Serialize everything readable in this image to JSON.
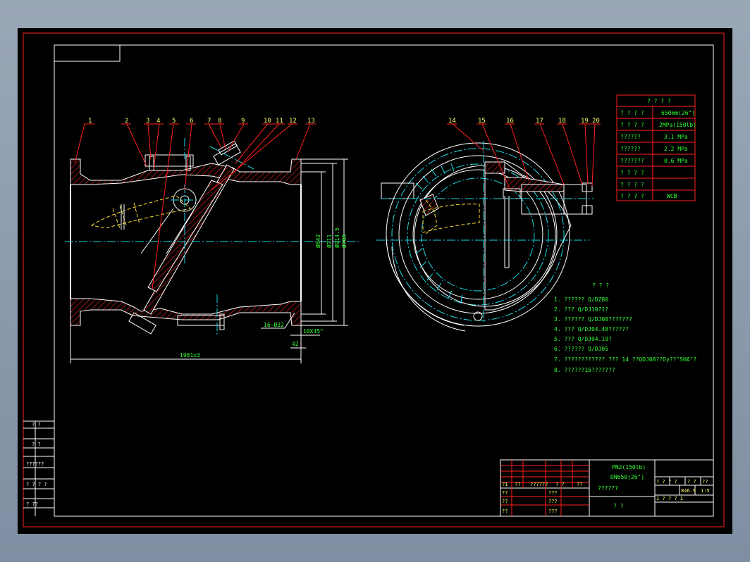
{
  "balloons": [
    "1",
    "2",
    "3",
    "4",
    "5",
    "6",
    "7",
    "8",
    "9",
    "10",
    "11",
    "12",
    "13",
    "14",
    "15",
    "16",
    "17",
    "18",
    "19",
    "20"
  ],
  "dimensions": {
    "overall_length": "1981±3",
    "dia_inner": "Ø642",
    "dia_mid": "Ø711",
    "dia_outer": "Ø914.5",
    "dia_flange": "Ø786",
    "bolt_holes": "16-Ø32",
    "chamfer": "10X45°",
    "gap": "42"
  },
  "spec_table": {
    "title": "? ? ? ?",
    "rows": [
      {
        "label": "? ? ? ?",
        "value": "650mm(26\")"
      },
      {
        "label": "? ? ? ?",
        "value": "2MPa(150lb)"
      },
      {
        "label": "??????",
        "value": "3.1 MPa"
      },
      {
        "label": "??????",
        "value": "2.2 MPa"
      },
      {
        "label": "???????",
        "value": "0.6 MPa"
      },
      {
        "label": "? ? ? ?",
        "value": ""
      },
      {
        "label": "? ? ? ?",
        "value": ""
      },
      {
        "label": "? ? ? ?",
        "value": "WCB"
      }
    ]
  },
  "notes": {
    "title": "? ? ?",
    "lines": [
      "1. ??????     Q/DZ80",
      "2. ???    Q/DJ10?1?",
      "3. ??????      Q/DJ08???????",
      "4. ???  Q/DJ04.48??????",
      "5. ???   Q/DJ04.19?",
      "6. ??????      Q/DJ05",
      "7. ????????????  ???     14    ??QDJ08??Dy??\"SHA\"?",
      "8. ??????15???????"
    ]
  },
  "title_block": {
    "spec1": "PN2(150lb)",
    "spec2": "DN650(26\")",
    "drawing_name": "??????",
    "company": "? ?",
    "scale_label": "? ? ? ?",
    "scale": "1:5",
    "qty_label": "? ?",
    "qty": "??",
    "weight": "846.9",
    "sheet_row": "1 ? ? ? 1",
    "rev_cells": [
      "?1",
      "??",
      "??????",
      "? ?",
      "??"
    ],
    "left_rows": [
      "??",
      "??",
      "??"
    ],
    "mid_cells": [
      "???",
      "???",
      "???"
    ]
  },
  "side_strip": [
    "? ?",
    "? ?",
    "??????",
    "? ? ? ?",
    "?   ??"
  ]
}
